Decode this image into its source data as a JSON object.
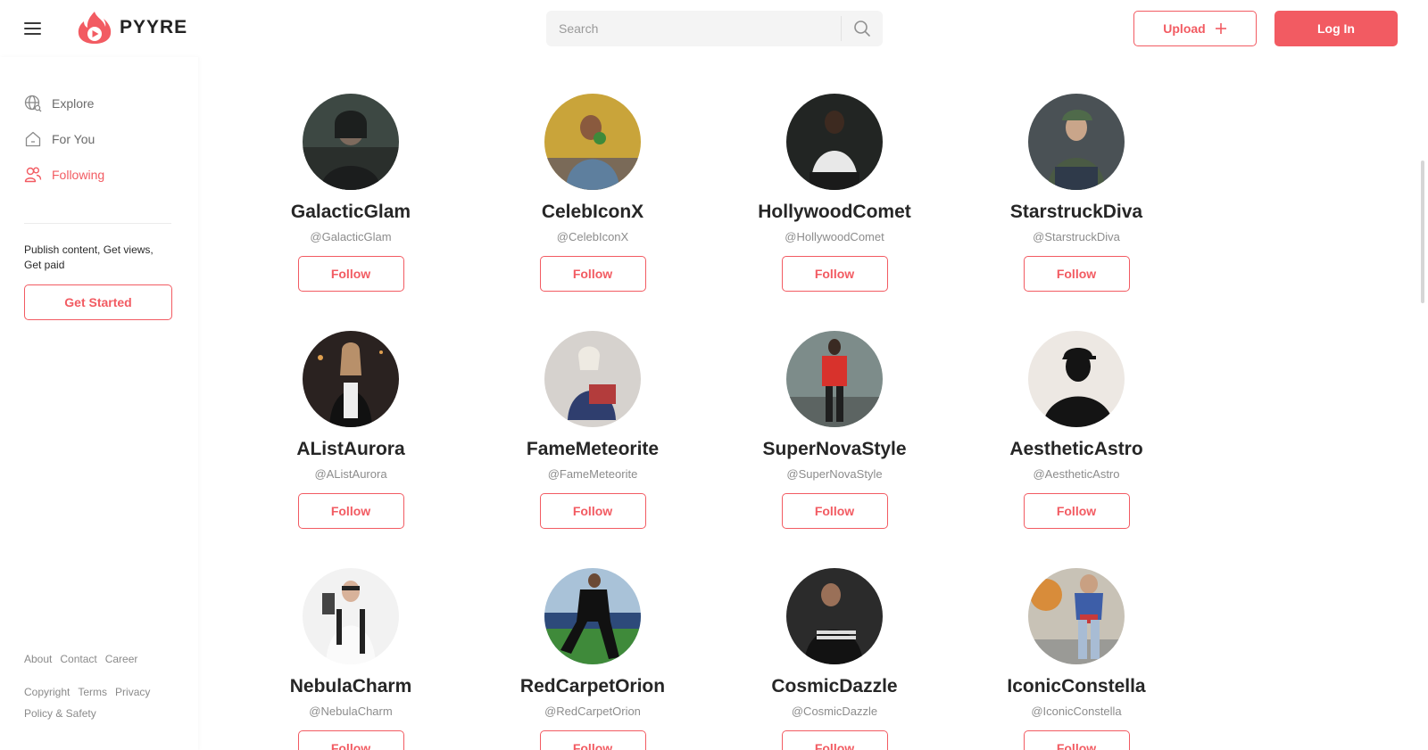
{
  "header": {
    "brand": "PYYRE",
    "search_placeholder": "Search",
    "upload_label": "Upload",
    "login_label": "Log In",
    "accent_color": "#f25b62"
  },
  "sidebar": {
    "nav": [
      {
        "label": "Explore",
        "icon": "globe-icon"
      },
      {
        "label": "For You",
        "icon": "home-icon"
      },
      {
        "label": "Following",
        "icon": "users-icon",
        "active": true
      }
    ],
    "promo_text": "Publish content, Get views, Get paid",
    "cta_label": "Get Started",
    "footer_row1": [
      "About",
      "Contact",
      "Career"
    ],
    "footer_row2": [
      "Copyright",
      "Terms",
      "Privacy"
    ],
    "footer_row3": [
      "Policy & Safety"
    ]
  },
  "creators": [
    {
      "name": "GalacticGlam",
      "handle": "@GalacticGlam",
      "follow_label": "Follow"
    },
    {
      "name": "CelebIconX",
      "handle": "@CelebIconX",
      "follow_label": "Follow"
    },
    {
      "name": "HollywoodComet",
      "handle": "@HollywoodComet",
      "follow_label": "Follow"
    },
    {
      "name": "StarstruckDiva",
      "handle": "@StarstruckDiva",
      "follow_label": "Follow"
    },
    {
      "name": "AListAurora",
      "handle": "@AListAurora",
      "follow_label": "Follow"
    },
    {
      "name": "FameMeteorite",
      "handle": "@FameMeteorite",
      "follow_label": "Follow"
    },
    {
      "name": "SuperNovaStyle",
      "handle": "@SuperNovaStyle",
      "follow_label": "Follow"
    },
    {
      "name": "AestheticAstro",
      "handle": "@AestheticAstro",
      "follow_label": "Follow"
    },
    {
      "name": "NebulaCharm",
      "handle": "@NebulaCharm",
      "follow_label": "Follow"
    },
    {
      "name": "RedCarpetOrion",
      "handle": "@RedCarpetOrion",
      "follow_label": "Follow"
    },
    {
      "name": "CosmicDazzle",
      "handle": "@CosmicDazzle",
      "follow_label": "Follow"
    },
    {
      "name": "IconicConstella",
      "handle": "@IconicConstella",
      "follow_label": "Follow"
    }
  ]
}
